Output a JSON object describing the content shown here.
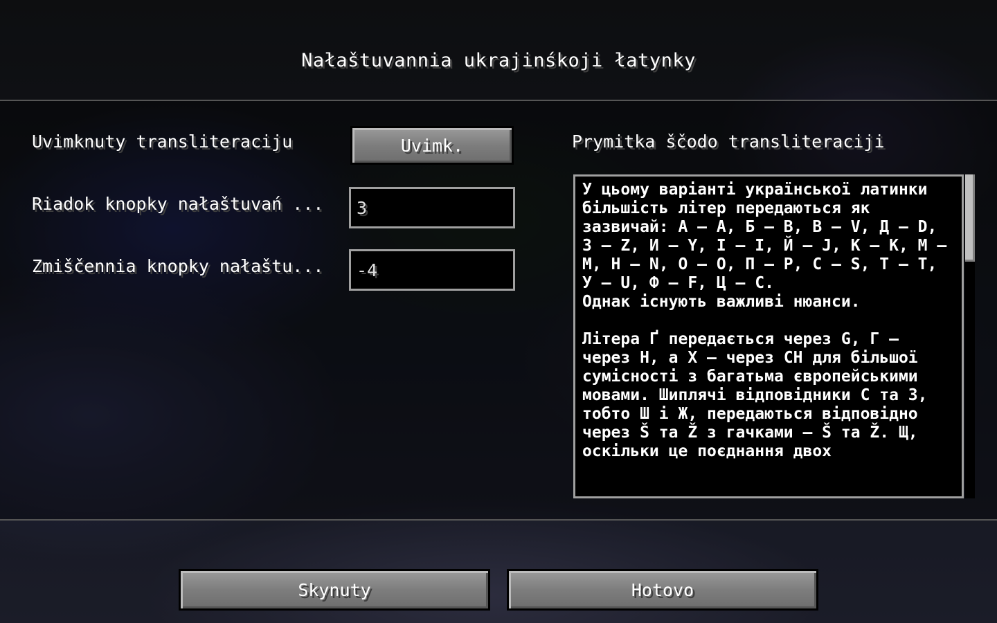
{
  "screen": {
    "title": "Nałaštuvannia ukrajinśkoji łatynky"
  },
  "settings": {
    "transliteration": {
      "label": "Uvimknuty transliteraciju",
      "button_label": "Uvimk."
    },
    "button_row": {
      "label": "Riadok knopky nałaštuvań ...",
      "value": "3"
    },
    "button_offset": {
      "label": "Zmiščennia knopky nałaštu...",
      "value": "-4"
    }
  },
  "note": {
    "heading": "Prymitka ščodo transliteraciji",
    "text": "У цьому варіанті української латинки більшість літер передаються як зазвичай: А — A, Б — B, В — V, Д — D, З — Z, И — Y, І — I, Й — J, К — K, М — M, Н — N, О — O, П — P, С — S, Т — T, У — U, Ф — F, Ц — C.\nОднак існують важливі нюанси.\n\nЛітера Ґ передається через G, Г — через H, а Х — через CH для більшої сумісності з багатьма європейськими мовами. Шиплячі відповідники С та З, тобто Ш і Ж, передаються відповідно через Š та Ž з гачками — Š та Ž. Щ, оскільки це поєднання двох"
  },
  "footer": {
    "reset_label": "Skynuty",
    "done_label": "Hotovo"
  }
}
